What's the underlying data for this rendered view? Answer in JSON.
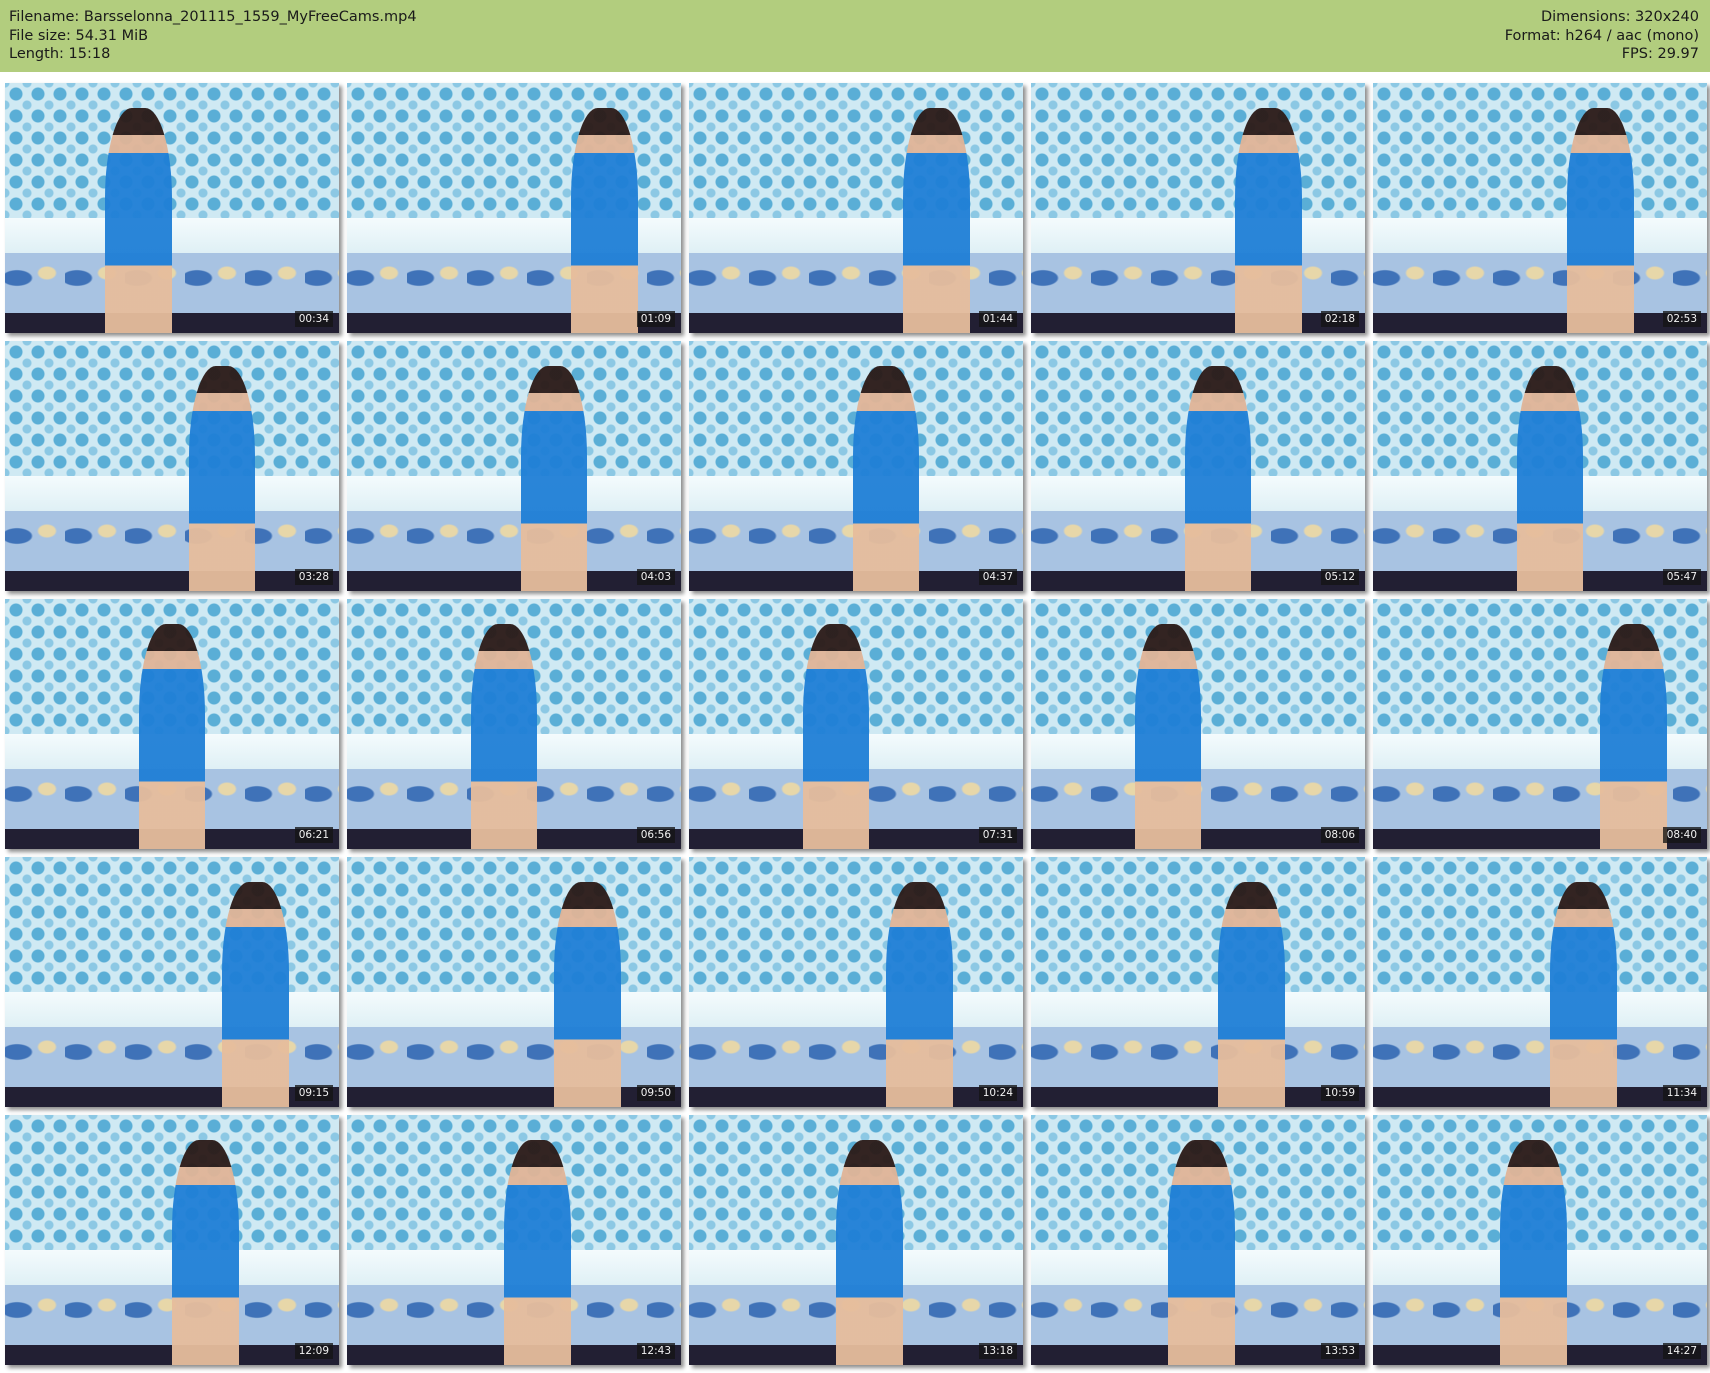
{
  "header": {
    "filename": "Filename: Barsselonna_201115_1559_MyFreeCams.mp4",
    "filesize": "File size: 54.31 MiB",
    "length": "Length: 15:18",
    "dimensions": "Dimensions: 320x240",
    "format": "Format: h264 / aac (mono)",
    "fps": "FPS: 29.97",
    "background_color": "#b2cd7e"
  },
  "thumbnails": [
    {
      "time": "00:34"
    },
    {
      "time": "01:09"
    },
    {
      "time": "01:44"
    },
    {
      "time": "02:18"
    },
    {
      "time": "02:53"
    },
    {
      "time": "03:28"
    },
    {
      "time": "04:03"
    },
    {
      "time": "04:37"
    },
    {
      "time": "05:12"
    },
    {
      "time": "05:47"
    },
    {
      "time": "06:21"
    },
    {
      "time": "06:56"
    },
    {
      "time": "07:31"
    },
    {
      "time": "08:06"
    },
    {
      "time": "08:40"
    },
    {
      "time": "09:15"
    },
    {
      "time": "09:50"
    },
    {
      "time": "10:24"
    },
    {
      "time": "10:59"
    },
    {
      "time": "11:34"
    },
    {
      "time": "12:09"
    },
    {
      "time": "12:43"
    },
    {
      "time": "13:18"
    },
    {
      "time": "13:53"
    },
    {
      "time": "14:27"
    }
  ]
}
